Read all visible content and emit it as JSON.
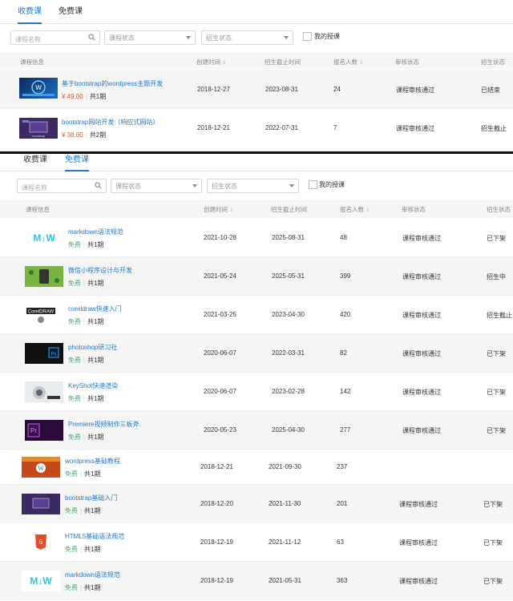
{
  "top": {
    "tabs": [
      "收费课",
      "免费课"
    ],
    "filters": {
      "search_placeholder": "课程名称",
      "course_status": "课程状态",
      "enroll_status": "招生状态",
      "my_courses": "我的授课"
    },
    "headers": {
      "info": "课程信息",
      "created": "创建时间",
      "deadline": "招生截止时间",
      "enrolled": "报名人数",
      "review": "审核状态",
      "status": "招生状态"
    },
    "rows": [
      {
        "title": "基于bootstrap的wordpress主题开发",
        "price": "¥ 49.00",
        "periods": "共1期",
        "created": "2018-12-27",
        "deadline": "2023-08-31",
        "enrolled": "24",
        "review": "课程审核通过",
        "status": "已结束"
      },
      {
        "title": "bootstrap网站开发（响应式网站）",
        "price": "¥ 38.00",
        "periods": "共2期",
        "created": "2018-12-21",
        "deadline": "2022-07-31",
        "enrolled": "7",
        "review": "课程审核通过",
        "status": "招生截止"
      }
    ]
  },
  "bottom": {
    "tabs": [
      "收费课",
      "免费课"
    ],
    "filters": {
      "search_placeholder": "课程名称",
      "course_status": "课程状态",
      "enroll_status": "招生状态",
      "my_courses": "我的授课"
    },
    "headers": {
      "info": "课程信息",
      "created": "创建时间",
      "deadline": "招生截止时间",
      "enrolled": "报名人数",
      "review": "审核状态",
      "status": "招生状态"
    },
    "free_label": "免费",
    "rows": [
      {
        "title": "markdown语法规范",
        "periods": "共1期",
        "created": "2021-10-28",
        "deadline": "2025-08-31",
        "enrolled": "48",
        "review": "课程审核通过",
        "status": "已下架",
        "thumb": "markdown",
        "thumb_text": "M↓W"
      },
      {
        "title": "微信小程序设计与开发",
        "periods": "共1期",
        "created": "2021-05-24",
        "deadline": "2025-05-31",
        "enrolled": "399",
        "review": "课程审核通过",
        "status": "招生中",
        "thumb": "wechat",
        "thumb_text": ""
      },
      {
        "title": "coreldraw快速入门",
        "periods": "共1期",
        "created": "2021-03-25",
        "deadline": "2023-04-30",
        "enrolled": "420",
        "review": "课程审核通过",
        "status": "招生截止",
        "thumb": "coreldraw",
        "thumb_text": "CorelDRAW"
      },
      {
        "title": "photoshop研习社",
        "periods": "共1期",
        "created": "2020-06-07",
        "deadline": "2022-03-31",
        "enrolled": "82",
        "review": "课程审核通过",
        "status": "已下架",
        "thumb": "photoshop",
        "thumb_text": "Ps"
      },
      {
        "title": "KeyShot快速渲染",
        "periods": "共1期",
        "created": "2020-06-07",
        "deadline": "2023-02-28",
        "enrolled": "142",
        "review": "课程审核通过",
        "status": "已下架",
        "thumb": "keyshot",
        "thumb_text": ""
      },
      {
        "title": "Premiere视频制作三板斧",
        "periods": "共1期",
        "created": "2020-05-23",
        "deadline": "2025-04-30",
        "enrolled": "277",
        "review": "课程审核通过",
        "status": "已下架",
        "thumb": "premiere",
        "thumb_text": "Pr"
      },
      {
        "title": "wordpress基础教程",
        "periods": "共1期",
        "created": "2018-12-21",
        "deadline": "2021-09-30",
        "enrolled": "237",
        "review": "",
        "status": "",
        "thumb": "wordpress",
        "thumb_text": "W"
      },
      {
        "title": "bootstrap基础入门",
        "periods": "共1期",
        "created": "2018-12-20",
        "deadline": "2021-11-30",
        "enrolled": "201",
        "review": "课程审核通过",
        "status": "已下架",
        "thumb": "bootstrap",
        "thumb_text": ""
      },
      {
        "title": "HTML5基础语法规范",
        "periods": "共1期",
        "created": "2018-12-19",
        "deadline": "2021-11-12",
        "enrolled": "63",
        "review": "课程审核通过",
        "status": "已下架",
        "thumb": "html5",
        "thumb_text": "5"
      },
      {
        "title": "markdown语法规范",
        "periods": "共1期",
        "created": "2018-12-19",
        "deadline": "2021-05-31",
        "enrolled": "363",
        "review": "课程审核通过",
        "status": "已下架",
        "thumb": "markdown",
        "thumb_text": "M↓W"
      }
    ]
  },
  "colors": {
    "accent": "#1f78d1",
    "price": "#e8531f",
    "free": "#3cb371"
  }
}
